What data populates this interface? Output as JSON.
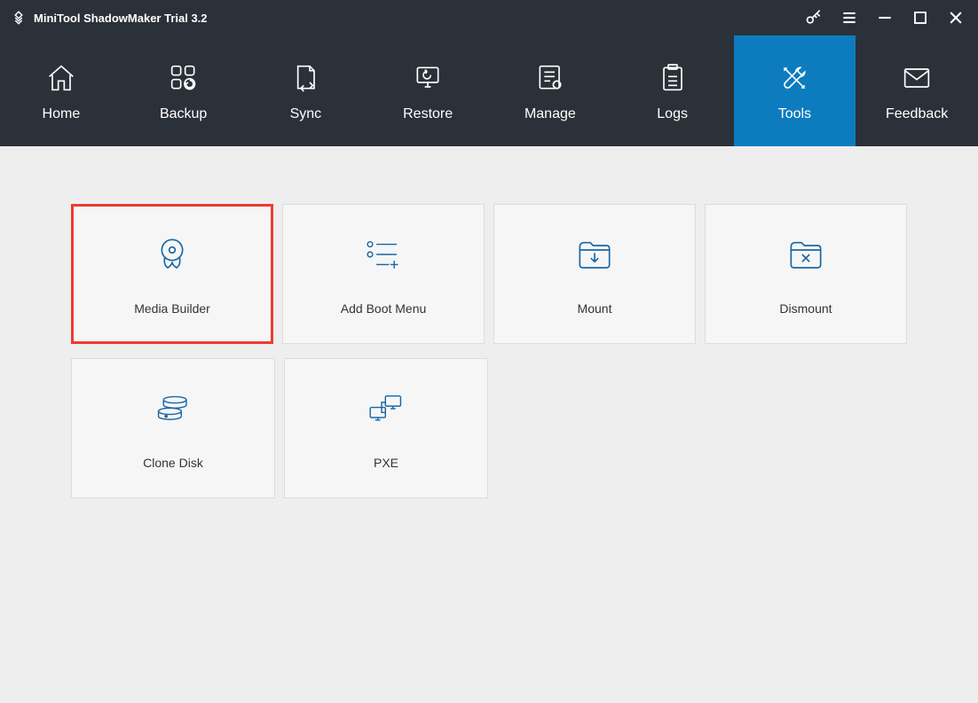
{
  "titlebar": {
    "title": "MiniTool ShadowMaker Trial 3.2"
  },
  "nav": {
    "items": [
      {
        "label": "Home"
      },
      {
        "label": "Backup"
      },
      {
        "label": "Sync"
      },
      {
        "label": "Restore"
      },
      {
        "label": "Manage"
      },
      {
        "label": "Logs"
      },
      {
        "label": "Tools"
      },
      {
        "label": "Feedback"
      }
    ]
  },
  "tiles": {
    "row1": [
      {
        "label": "Media Builder"
      },
      {
        "label": "Add Boot Menu"
      },
      {
        "label": "Mount"
      },
      {
        "label": "Dismount"
      }
    ],
    "row2": [
      {
        "label": "Clone Disk"
      },
      {
        "label": "PXE"
      }
    ]
  }
}
